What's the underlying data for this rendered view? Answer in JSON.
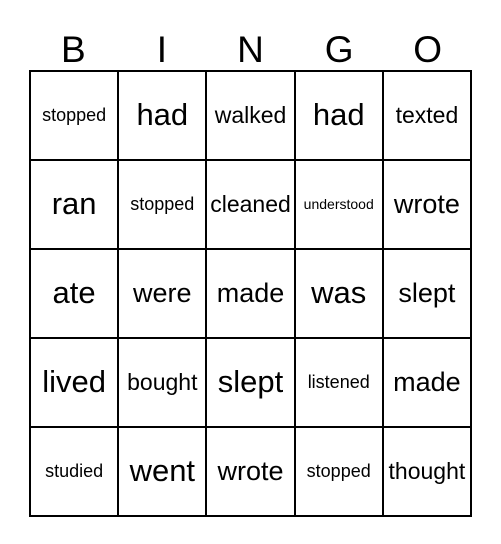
{
  "card": {
    "headers": [
      "B",
      "I",
      "N",
      "G",
      "O"
    ],
    "rows": [
      [
        {
          "word": "stopped",
          "size": "sz-sm"
        },
        {
          "word": "had",
          "size": "sz-xl"
        },
        {
          "word": "walked",
          "size": "sz-md"
        },
        {
          "word": "had",
          "size": "sz-xl"
        },
        {
          "word": "texted",
          "size": "sz-md"
        }
      ],
      [
        {
          "word": "ran",
          "size": "sz-xl"
        },
        {
          "word": "stopped",
          "size": "sz-sm"
        },
        {
          "word": "cleaned",
          "size": "sz-md"
        },
        {
          "word": "understood",
          "size": "sz-xs"
        },
        {
          "word": "wrote",
          "size": "sz-lg"
        }
      ],
      [
        {
          "word": "ate",
          "size": "sz-xl"
        },
        {
          "word": "were",
          "size": "sz-lg"
        },
        {
          "word": "made",
          "size": "sz-lg"
        },
        {
          "word": "was",
          "size": "sz-xl"
        },
        {
          "word": "slept",
          "size": "sz-lg"
        }
      ],
      [
        {
          "word": "lived",
          "size": "sz-xl"
        },
        {
          "word": "bought",
          "size": "sz-md"
        },
        {
          "word": "slept",
          "size": "sz-xl"
        },
        {
          "word": "listened",
          "size": "sz-sm"
        },
        {
          "word": "made",
          "size": "sz-lg"
        }
      ],
      [
        {
          "word": "studied",
          "size": "sz-sm"
        },
        {
          "word": "went",
          "size": "sz-xl"
        },
        {
          "word": "wrote",
          "size": "sz-lg"
        },
        {
          "word": "stopped",
          "size": "sz-sm"
        },
        {
          "word": "thought",
          "size": "sz-md"
        }
      ]
    ]
  },
  "colors": {
    "border": "#000000",
    "background": "#ffffff",
    "text": "#000000"
  }
}
